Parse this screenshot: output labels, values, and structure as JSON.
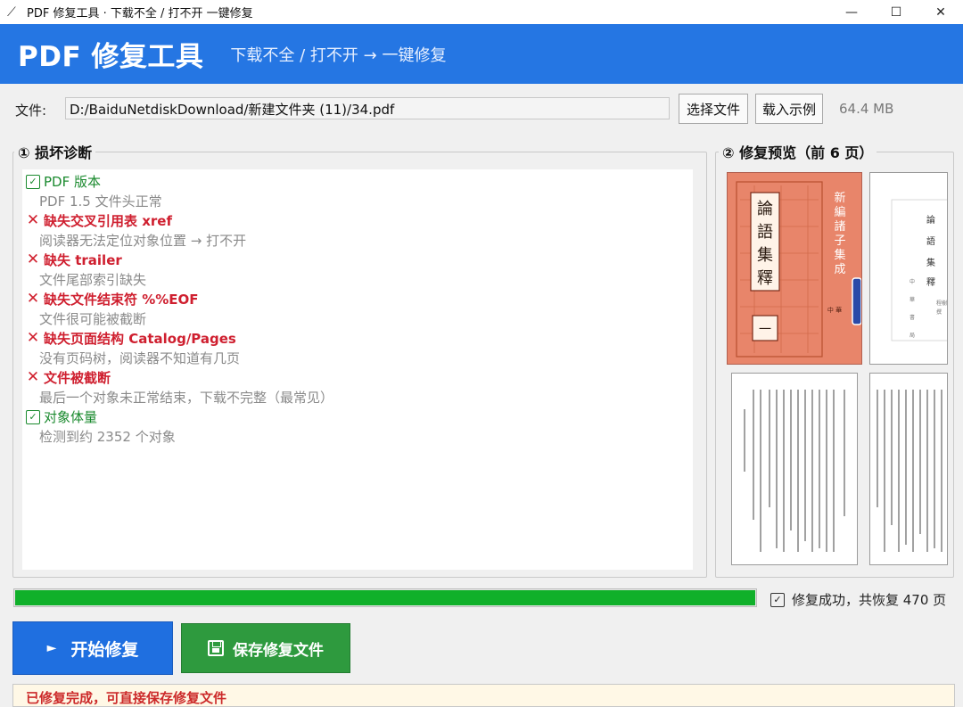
{
  "window": {
    "title": "PDF 修复工具 · 下载不全 / 打不开 一键修复",
    "minimize": "—",
    "maximize": "☐",
    "close": "✕"
  },
  "banner": {
    "title": "PDF 修复工具",
    "subtitle": "下载不全 / 打不开 → 一键修复"
  },
  "file": {
    "label": "文件:",
    "path": "D:/BaiduNetdiskDownload/新建文件夹 (11)/34.pdf",
    "choose_label": "选择文件",
    "sample_label": "载入示例",
    "size": "64.4 MB"
  },
  "diagnostics": {
    "title": "① 损坏诊断",
    "items": [
      {
        "status": "ok",
        "title": "PDF 版本",
        "detail": "PDF 1.5 文件头正常"
      },
      {
        "status": "bad",
        "title": "缺失交叉引用表 xref",
        "detail": "阅读器无法定位对象位置 → 打不开"
      },
      {
        "status": "bad",
        "title": "缺失 trailer",
        "detail": "文件尾部索引缺失"
      },
      {
        "status": "bad",
        "title": "缺失文件结束符 %%EOF",
        "detail": "文件很可能被截断"
      },
      {
        "status": "bad",
        "title": "缺失页面结构 Catalog/Pages",
        "detail": "没有页码树，阅读器不知道有几页"
      },
      {
        "status": "bad",
        "title": "文件被截断",
        "detail": "最后一个对象未正常结束，下载不完整（最常见）"
      },
      {
        "status": "ok",
        "title": "对象体量",
        "detail": "检测到约 2352 个对象"
      }
    ]
  },
  "preview": {
    "title": "② 修复预览（前 6 页）",
    "cover_text": "論語集釋",
    "cover_side": "新編諸子集成"
  },
  "progress": {
    "value": 1.0,
    "status": "修复成功，共恢复 470 页"
  },
  "actions": {
    "start_label": "开始修复",
    "save_label": "保存修复文件"
  },
  "log": {
    "text": "已修复完成，可直接保存修复文件"
  },
  "colors": {
    "accent": "#2576e3",
    "success": "#10b02a",
    "error": "#cf1f2f",
    "save": "#2e9a3e"
  }
}
